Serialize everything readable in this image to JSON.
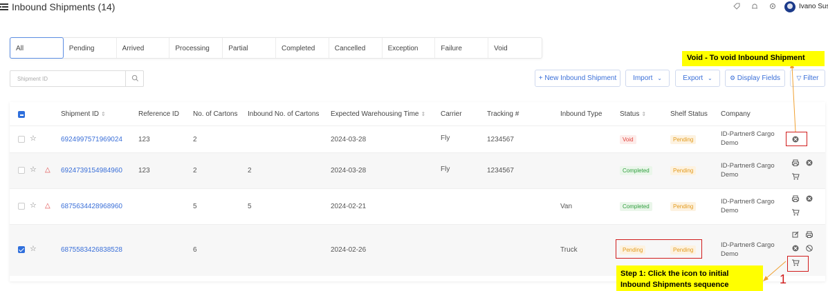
{
  "header": {
    "title": "Inbound Shipments (14)",
    "user_name": "Ivano Susa"
  },
  "tabs": [
    "All",
    "Pending",
    "Arrived",
    "Processing",
    "Partial",
    "Completed",
    "Cancelled",
    "Exception",
    "Failure",
    "Void"
  ],
  "toolbar": {
    "search_placeholder": "Shipment ID",
    "new_label": "+ New Inbound Shipment",
    "import_label": "Import",
    "export_label": "Export",
    "display_fields_label": "Display Fields",
    "filter_label": "Filter"
  },
  "table": {
    "columns": [
      "Shipment ID",
      "Reference ID",
      "No. of Cartons",
      "Inbound No. of Cartons",
      "Expected Warehousing Time",
      "Carrier",
      "Tracking #",
      "Inbound Type",
      "Status",
      "Shelf Status",
      "Company"
    ],
    "rows": [
      {
        "shipment_id": "6924997571969024",
        "reference_id": "123",
        "cartons": "2",
        "inbound_cartons": "",
        "expected_time": "2024-03-28",
        "carrier": "Fly",
        "tracking": "1234567",
        "inbound_type": "",
        "status": "Void",
        "shelf_status": "Pending",
        "company_line1": "ID-Partner8 Cargo",
        "company_line2": "Demo"
      },
      {
        "shipment_id": "6924739154984960",
        "reference_id": "123",
        "cartons": "2",
        "inbound_cartons": "2",
        "expected_time": "2024-03-28",
        "carrier": "Fly",
        "tracking": "1234567",
        "inbound_type": "",
        "status": "Completed",
        "shelf_status": "Pending",
        "company_line1": "ID-Partner8 Cargo",
        "company_line2": "Demo"
      },
      {
        "shipment_id": "6875634428968960",
        "reference_id": "",
        "cartons": "5",
        "inbound_cartons": "5",
        "expected_time": "2024-02-21",
        "carrier": "",
        "tracking": "",
        "inbound_type": "Van",
        "status": "Completed",
        "shelf_status": "Pending",
        "company_line1": "ID-Partner8 Cargo",
        "company_line2": "Demo"
      },
      {
        "shipment_id": "6875583426838528",
        "reference_id": "",
        "cartons": "6",
        "inbound_cartons": "",
        "expected_time": "2024-02-26",
        "carrier": "",
        "tracking": "",
        "inbound_type": "Truck",
        "status": "Pending",
        "shelf_status": "Pending",
        "company_line1": "ID-Partner8 Cargo",
        "company_line2": "Demo"
      }
    ]
  },
  "annotations": {
    "void_callout": "Void - To void Inbound Shipment",
    "step1_line1": "Step 1: Click the icon to initial",
    "step1_line2": "Inbound Shipments sequence",
    "step_number": "1",
    "callout_bg": "#ffff00",
    "marker_color": "#d01a1a"
  },
  "colors": {
    "accent": "#3a6fd8",
    "void": "#e0443c",
    "completed": "#2e9e3c",
    "pending": "#e39b1c"
  },
  "icons": [
    "menu-icon",
    "tag-icon",
    "bell-icon",
    "gear-icon",
    "search-icon",
    "star-icon",
    "warning-icon",
    "print-icon",
    "void-icon",
    "cart-icon",
    "edit-icon",
    "cancel-icon",
    "sort-icon",
    "chevron-down-icon",
    "filter-icon"
  ]
}
